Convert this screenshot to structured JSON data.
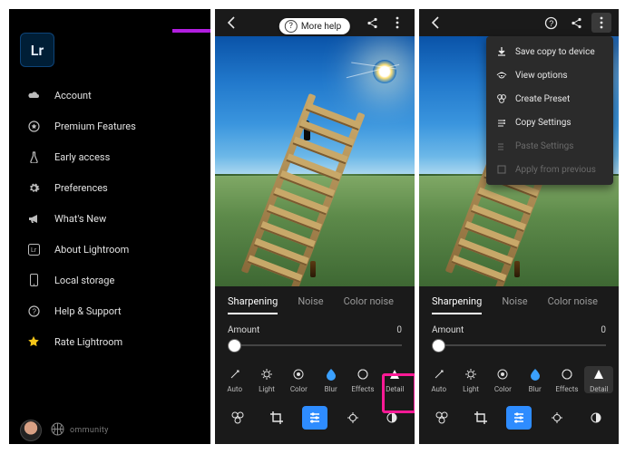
{
  "sidebar": {
    "logo": "Lr",
    "items": [
      {
        "icon": "cloud-icon",
        "label": "Account"
      },
      {
        "icon": "star-circle-icon",
        "label": "Premium Features"
      },
      {
        "icon": "flask-icon",
        "label": "Early access"
      },
      {
        "icon": "gear-icon",
        "label": "Preferences"
      },
      {
        "icon": "megaphone-icon",
        "label": "What's New"
      },
      {
        "icon": "lr-box-icon",
        "label": "About Lightroom"
      },
      {
        "icon": "phone-icon",
        "label": "Local storage"
      },
      {
        "icon": "help-icon",
        "label": "Help & Support"
      },
      {
        "icon": "star-icon",
        "label": "Rate Lightroom"
      }
    ],
    "bottom_label": "ommunity"
  },
  "more_help": "More help",
  "detail": {
    "tabs": [
      "Sharpening",
      "Noise",
      "Color noise"
    ],
    "slider_label": "Amount",
    "slider_value": "0",
    "tools": [
      "Auto",
      "Light",
      "Color",
      "Blur",
      "Effects",
      "Detail"
    ]
  },
  "dropdown": [
    {
      "icon": "download-icon",
      "label": "Save copy to device",
      "enabled": true
    },
    {
      "icon": "view-icon",
      "label": "View options",
      "enabled": true
    },
    {
      "icon": "preset-icon",
      "label": "Create Preset",
      "enabled": true
    },
    {
      "icon": "copy-settings-icon",
      "label": "Copy Settings",
      "enabled": true
    },
    {
      "icon": "paste-settings-icon",
      "label": "Paste Settings",
      "enabled": false
    },
    {
      "icon": "apply-previous-icon",
      "label": "Apply from previous",
      "enabled": false
    }
  ]
}
